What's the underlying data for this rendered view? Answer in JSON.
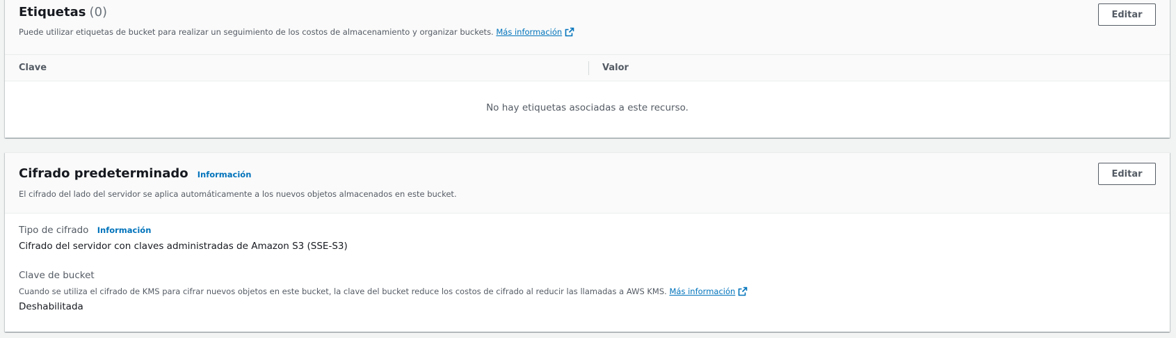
{
  "tags": {
    "title": "Etiquetas",
    "count": "(0)",
    "description": "Puede utilizar etiquetas de bucket para realizar un seguimiento de los costos de almacenamiento y organizar buckets.",
    "learn_more": "Más información",
    "edit_label": "Editar",
    "columns": [
      "Clave",
      "Valor"
    ],
    "empty_message": "No hay etiquetas asociadas a este recurso."
  },
  "encryption": {
    "title": "Cifrado predeterminado",
    "info_link": "Información",
    "description": "El cifrado del lado del servidor se aplica automáticamente a los nuevos objetos almacenados en este bucket.",
    "edit_label": "Editar",
    "type_label": "Tipo de cifrado",
    "type_info_link": "Información",
    "type_value": "Cifrado del servidor con claves administradas de Amazon S3 (SSE-S3)",
    "bucket_key_label": "Clave de bucket",
    "bucket_key_description": "Cuando se utiliza el cifrado de KMS para cifrar nuevos objetos en este bucket, la clave del bucket reduce los costos de cifrado al reducir las llamadas a AWS KMS.",
    "bucket_key_learn_more": "Más información",
    "bucket_key_value": "Deshabilitada"
  },
  "icons": {
    "external_link": "external-link-icon"
  },
  "colors": {
    "link": "#0073bb",
    "text": "#16191f",
    "secondary_text": "#545b64",
    "background": "#f2f3f3"
  }
}
